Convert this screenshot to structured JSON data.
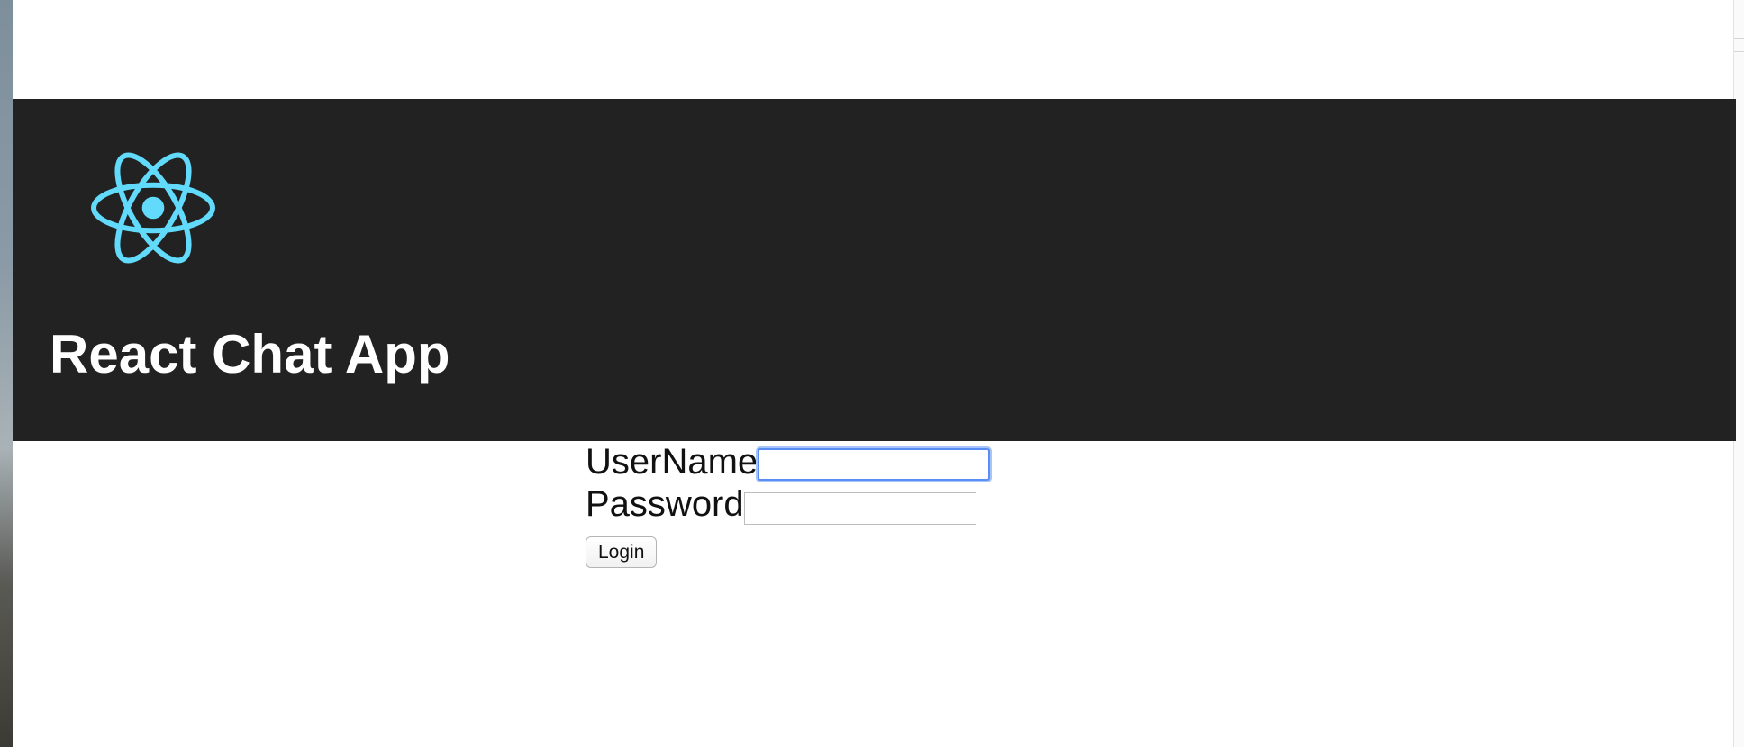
{
  "app": {
    "title": "React Chat App",
    "logo_icon": "react-atom-icon",
    "accent_color": "#61dafb",
    "header_color": "#222222"
  },
  "login": {
    "username_label": "UserName",
    "username_value": "",
    "password_label": "Password",
    "password_value": "",
    "login_button_label": "Login"
  }
}
